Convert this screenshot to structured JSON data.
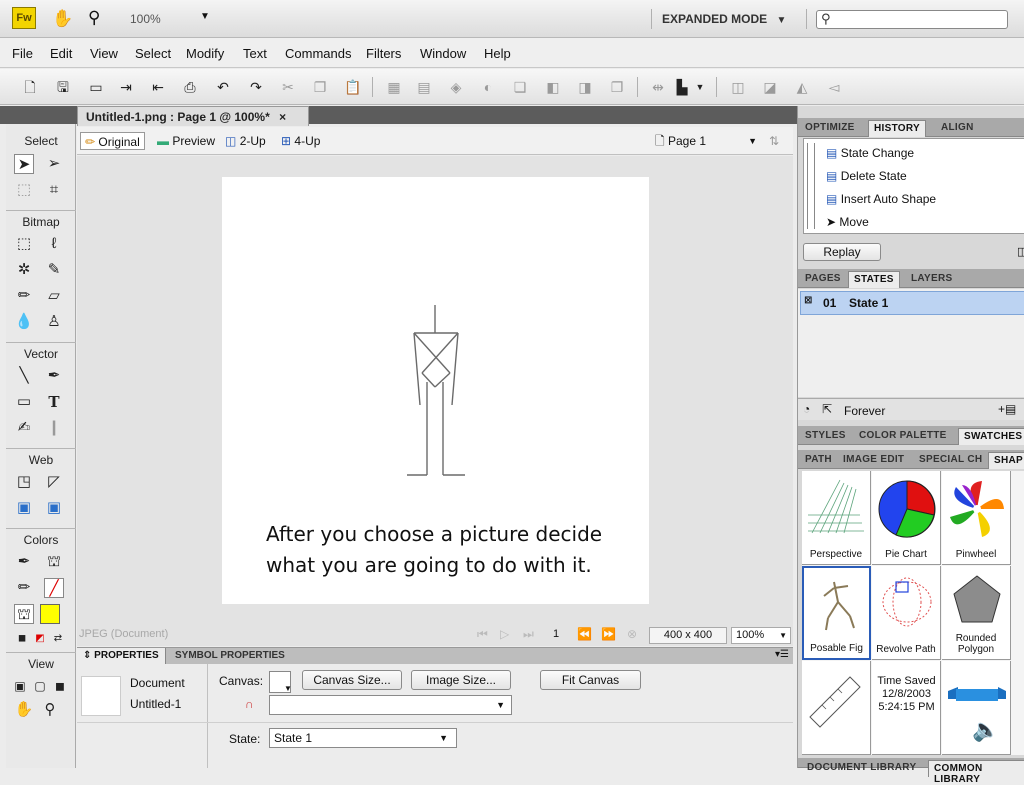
{
  "app": {
    "logo": "Fw",
    "zoom": "100%",
    "mode": "EXPANDED MODE"
  },
  "menu": [
    "File",
    "Edit",
    "View",
    "Select",
    "Modify",
    "Text",
    "Commands",
    "Filters",
    "Window",
    "Help"
  ],
  "tools": {
    "sections": [
      "Select",
      "Bitmap",
      "Vector",
      "Web",
      "Colors",
      "View"
    ]
  },
  "document": {
    "tab_title": "Untitled-1.png : Page 1 @ 100%*",
    "close": "×",
    "views": [
      "Original",
      "Preview",
      "2-Up",
      "4-Up"
    ],
    "page": "Page 1",
    "caption": "After you choose a picture decide what you are going to do with it."
  },
  "statusbar": {
    "format": "JPEG (Document)",
    "frame": "1",
    "size": "400 x 400",
    "zoom": "100%"
  },
  "properties": {
    "tabs": [
      "PROPERTIES",
      "SYMBOL PROPERTIES"
    ],
    "doc_type": "Document",
    "doc_name": "Untitled-1",
    "canvas_label": "Canvas:",
    "canvas_size_btn": "Canvas Size...",
    "image_size_btn": "Image Size...",
    "fit_canvas_btn": "Fit Canvas",
    "state_label": "State:",
    "state_value": "State 1"
  },
  "panels": {
    "top_tabs": [
      "OPTIMIZE",
      "HISTORY",
      "ALIGN"
    ],
    "history": [
      "State Change",
      "Delete State",
      "Insert Auto Shape",
      "Move"
    ],
    "replay": "Replay",
    "mid_tabs": [
      "PAGES",
      "STATES",
      "LAYERS"
    ],
    "state_num": "01",
    "state_name": "State 1",
    "loop": "Forever",
    "style_tabs": [
      "STYLES",
      "COLOR PALETTE",
      "SWATCHES"
    ],
    "shape_tabs": [
      "PATH",
      "IMAGE EDIT",
      "SPECIAL CH",
      "SHAP"
    ],
    "shapes": [
      "Perspective",
      "Pie Chart",
      "Pinwheel",
      "Posable Fig",
      "Revolve Path",
      "Rounded Polygon"
    ],
    "time_saved": [
      "Time Saved",
      "12/8/2003",
      "5:24:15 PM"
    ],
    "bottom_tabs": [
      "DOCUMENT LIBRARY",
      "COMMON LIBRARY"
    ]
  }
}
